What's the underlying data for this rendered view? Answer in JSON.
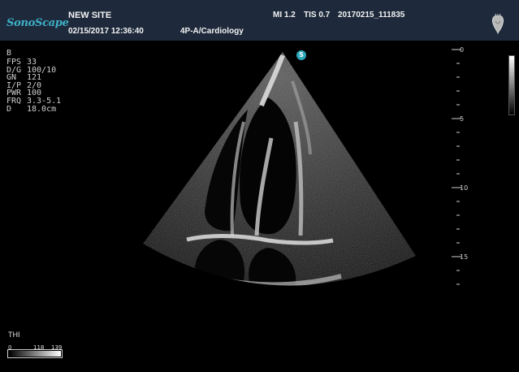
{
  "header": {
    "logo": "SonoScape",
    "site": "NEW SITE",
    "datetime": "02/15/2017 12:36:40",
    "preset": "4P-A/Cardiology",
    "mi": "MI 1.2",
    "tis": "TIS 0.7",
    "image_id": "20170215_111835"
  },
  "mode": "B",
  "params": [
    {
      "key": "FPS",
      "value": "33"
    },
    {
      "key": "D/G",
      "value": "100/10"
    },
    {
      "key": "GN",
      "value": "121"
    },
    {
      "key": "I/P",
      "value": "2/0"
    },
    {
      "key": "PWR",
      "value": "100"
    },
    {
      "key": "FRQ",
      "value": "3.3-5.1"
    },
    {
      "key": "D",
      "value": "18.0cm"
    }
  ],
  "depth_scale": {
    "labels": [
      "0",
      "5",
      "10",
      "15"
    ]
  },
  "focus_marker": "S",
  "thi": "THI",
  "dynamic_scale": {
    "labels": [
      "0",
      "118",
      "139"
    ]
  },
  "icons": [
    "heart-icon",
    "focus-marker-icon"
  ],
  "colors": {
    "header_bg": "#1e2a3b",
    "logo": "#3fb0c8",
    "marker": "#2aa7b8"
  }
}
